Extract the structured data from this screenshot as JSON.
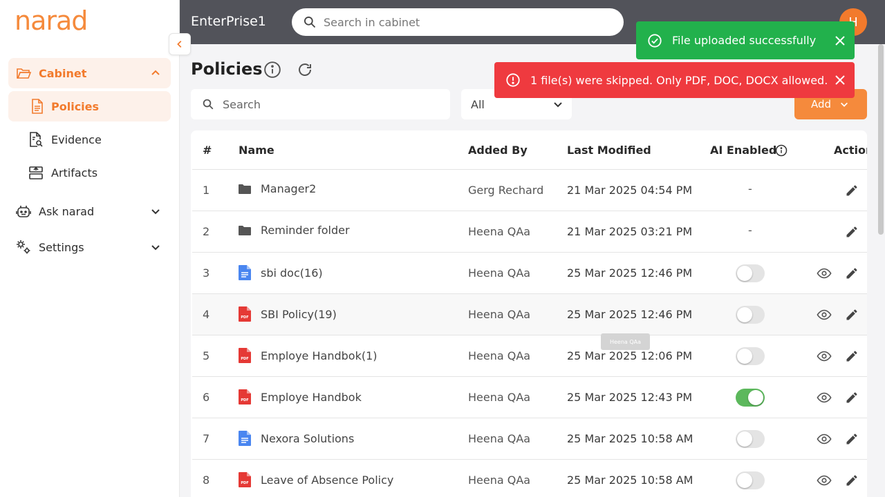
{
  "brand": {
    "logo": "narad",
    "accent": "#f27a2c"
  },
  "sidebar": {
    "cabinet": "Cabinet",
    "items": [
      {
        "label": "Policies",
        "icon": "document-icon"
      },
      {
        "label": "Evidence",
        "icon": "file-search-icon"
      },
      {
        "label": "Artifacts",
        "icon": "artifact-icon"
      }
    ],
    "ask": "Ask narad",
    "settings": "Settings"
  },
  "header": {
    "org": "EnterPrise1",
    "search_placeholder": "Search in cabinet",
    "avatar": "H"
  },
  "page": {
    "title": "Policies",
    "search_placeholder": "Search",
    "filter_value": "All",
    "add_label": "Add"
  },
  "toasts": {
    "success": "File uploaded successfully",
    "error": "1 file(s) were skipped. Only PDF, DOC, DOCX allowed."
  },
  "table": {
    "columns": [
      "#",
      "Name",
      "Added By",
      "Last Modified",
      "AI Enabled",
      "Action"
    ],
    "rows": [
      {
        "n": "1",
        "name": "Manager2",
        "type": "folder",
        "by": "Gerg Rechard",
        "modified": "21 Mar 2025 04:54 PM",
        "ai": "-"
      },
      {
        "n": "2",
        "name": "Reminder folder",
        "type": "folder",
        "by": "Heena QAa",
        "modified": "21 Mar 2025 03:21 PM",
        "ai": "-"
      },
      {
        "n": "3",
        "name": "sbi doc(16)",
        "type": "doc",
        "by": "Heena QAa",
        "modified": "25 Mar 2025 12:46 PM",
        "ai": false
      },
      {
        "n": "4",
        "name": "SBI Policy(19)",
        "type": "pdf",
        "by": "Heena QAa",
        "modified": "25 Mar 2025 12:46 PM",
        "ai": false
      },
      {
        "n": "5",
        "name": "Employe Handbok(1)",
        "type": "pdf",
        "by": "Heena QAa",
        "modified": "25 Mar 2025 12:06 PM",
        "ai": false
      },
      {
        "n": "6",
        "name": "Employe Handbok",
        "type": "pdf",
        "by": "Heena QAa",
        "modified": "25 Mar 2025 12:43 PM",
        "ai": true
      },
      {
        "n": "7",
        "name": "Nexora Solutions",
        "type": "doc",
        "by": "Heena QAa",
        "modified": "25 Mar 2025 10:58 AM",
        "ai": false
      },
      {
        "n": "8",
        "name": "Leave of Absence Policy",
        "type": "pdf",
        "by": "Heena QAa",
        "modified": "25 Mar 2025 10:58 AM",
        "ai": false
      }
    ]
  },
  "tooltip": "Heena QAa"
}
